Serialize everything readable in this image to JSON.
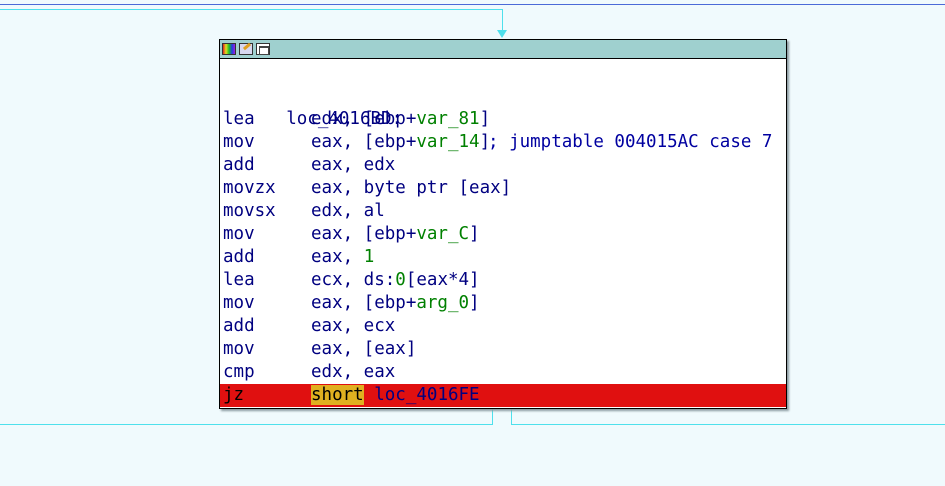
{
  "block": {
    "label": "loc_4016BD:",
    "comment": "; jumptable 004015AC case 7",
    "instructions": [
      {
        "mn": "lea",
        "pre": "edx, [ebp+",
        "var": "var_81",
        "post": "]"
      },
      {
        "mn": "mov",
        "pre": "eax, [ebp+",
        "var": "var_14",
        "post": "]"
      },
      {
        "mn": "add",
        "pre": "eax, edx",
        "var": "",
        "post": ""
      },
      {
        "mn": "movzx",
        "pre": "eax, byte ptr [eax]",
        "var": "",
        "post": ""
      },
      {
        "mn": "movsx",
        "pre": "edx, al",
        "var": "",
        "post": ""
      },
      {
        "mn": "mov",
        "pre": "eax, [ebp+",
        "var": "var_C",
        "post": "]"
      },
      {
        "mn": "add",
        "pre": "eax, ",
        "var": "1",
        "post": ""
      },
      {
        "mn": "lea",
        "pre": "ecx, ds:",
        "var": "0",
        "post": "[eax*4]"
      },
      {
        "mn": "mov",
        "pre": "eax, [ebp+",
        "var": "arg_0",
        "post": "]"
      },
      {
        "mn": "add",
        "pre": "eax, ecx",
        "var": "",
        "post": ""
      },
      {
        "mn": "mov",
        "pre": "eax, [eax]",
        "var": "",
        "post": ""
      },
      {
        "mn": "cmp",
        "pre": "edx, eax",
        "var": "",
        "post": ""
      }
    ],
    "jump": {
      "mn": "jz",
      "kw": "short",
      "target": "loc_4016FE"
    }
  },
  "colors": {
    "background": "#f0fafd",
    "edge": "#4ee0ec",
    "highlight": "#e01010",
    "keyword_bg": "#e0b020",
    "variable": "#008000",
    "code": "#000080"
  }
}
